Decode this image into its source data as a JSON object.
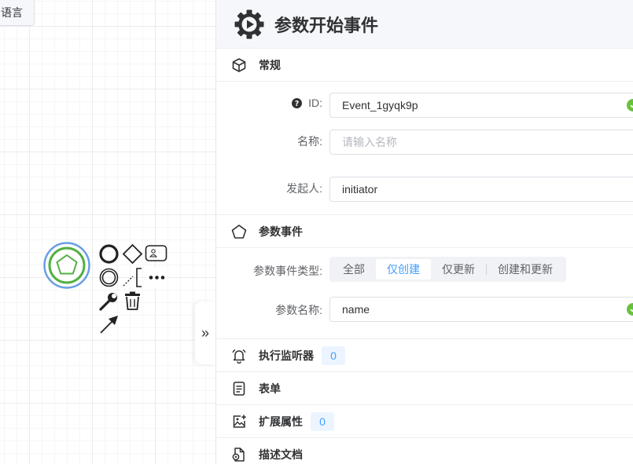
{
  "canvas": {
    "lang_button": "语言",
    "toggle_label": "»"
  },
  "panel": {
    "title": "参数开始事件",
    "sections": {
      "general": {
        "title": "常规",
        "id_label": "ID:",
        "id_value": "Event_1gyqk9p",
        "name_label": "名称:",
        "name_placeholder": "请输入名称",
        "initiator_label": "发起人:",
        "initiator_value": "initiator"
      },
      "param_event": {
        "title": "参数事件",
        "type_label": "参数事件类型:",
        "type_options": [
          "全部",
          "仅创建",
          "仅更新",
          "创建和更新"
        ],
        "type_selected": "仅创建",
        "name_label": "参数名称:",
        "name_value": "name"
      },
      "listeners": {
        "title": "执行监听器",
        "count": "0"
      },
      "form": {
        "title": "表单"
      },
      "ext": {
        "title": "扩展属性",
        "count": "0"
      },
      "doc": {
        "title": "描述文档"
      }
    }
  },
  "colors": {
    "accent": "#409eff",
    "success": "#67c23a",
    "event_green": "#52b043",
    "selection_blue": "#6a9ee6"
  }
}
